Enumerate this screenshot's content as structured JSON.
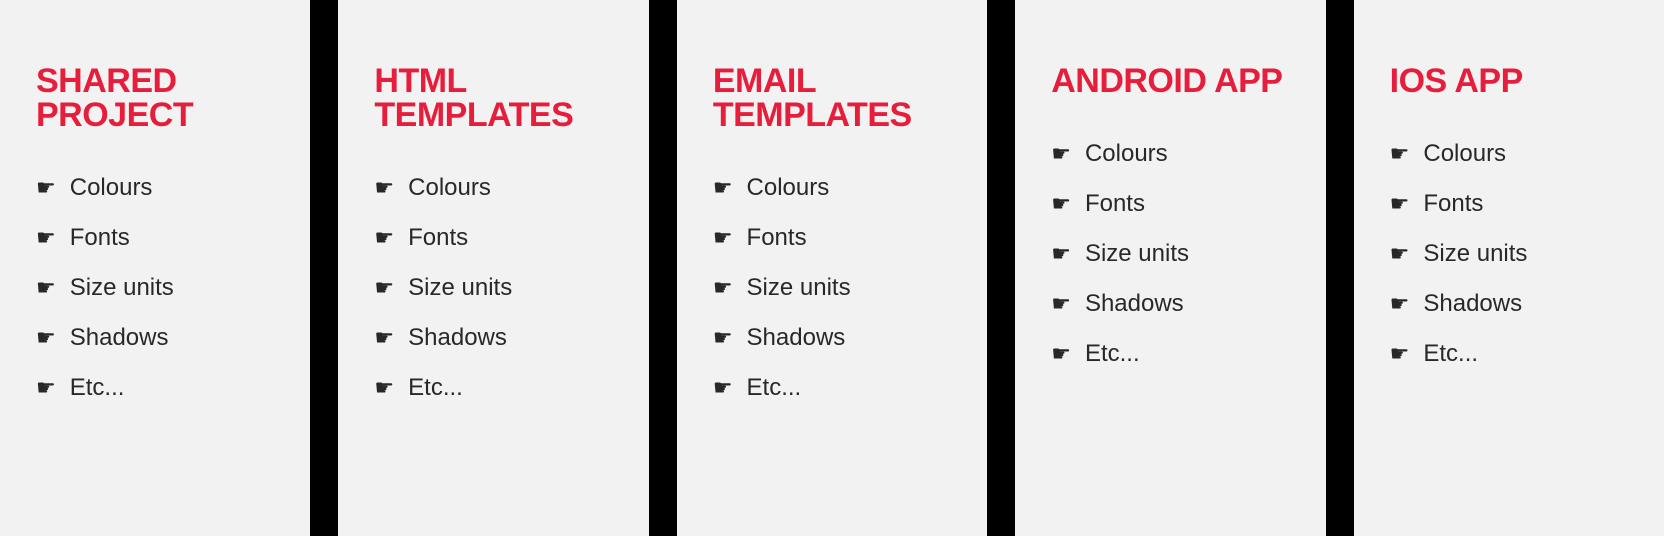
{
  "columns": [
    {
      "title": "SHARED PROJECT",
      "items": [
        "Colours",
        "Fonts",
        "Size units",
        "Shadows",
        "Etc..."
      ]
    },
    {
      "title": "HTML TEMPLATES",
      "items": [
        "Colours",
        "Fonts",
        "Size units",
        "Shadows",
        "Etc..."
      ]
    },
    {
      "title": "EMAIL TEMPLATES",
      "items": [
        "Colours",
        "Fonts",
        "Size units",
        "Shadows",
        "Etc..."
      ]
    },
    {
      "title": "ANDROID APP",
      "items": [
        "Colours",
        "Fonts",
        "Size units",
        "Shadows",
        "Etc..."
      ]
    },
    {
      "title": "IOS APP",
      "items": [
        "Colours",
        "Fonts",
        "Size units",
        "Shadows",
        "Etc..."
      ]
    }
  ],
  "colors": {
    "accent": "#e61e3c",
    "text": "#2a272a",
    "panel_bg": "#f2f2f2",
    "page_bg": "#000000"
  }
}
